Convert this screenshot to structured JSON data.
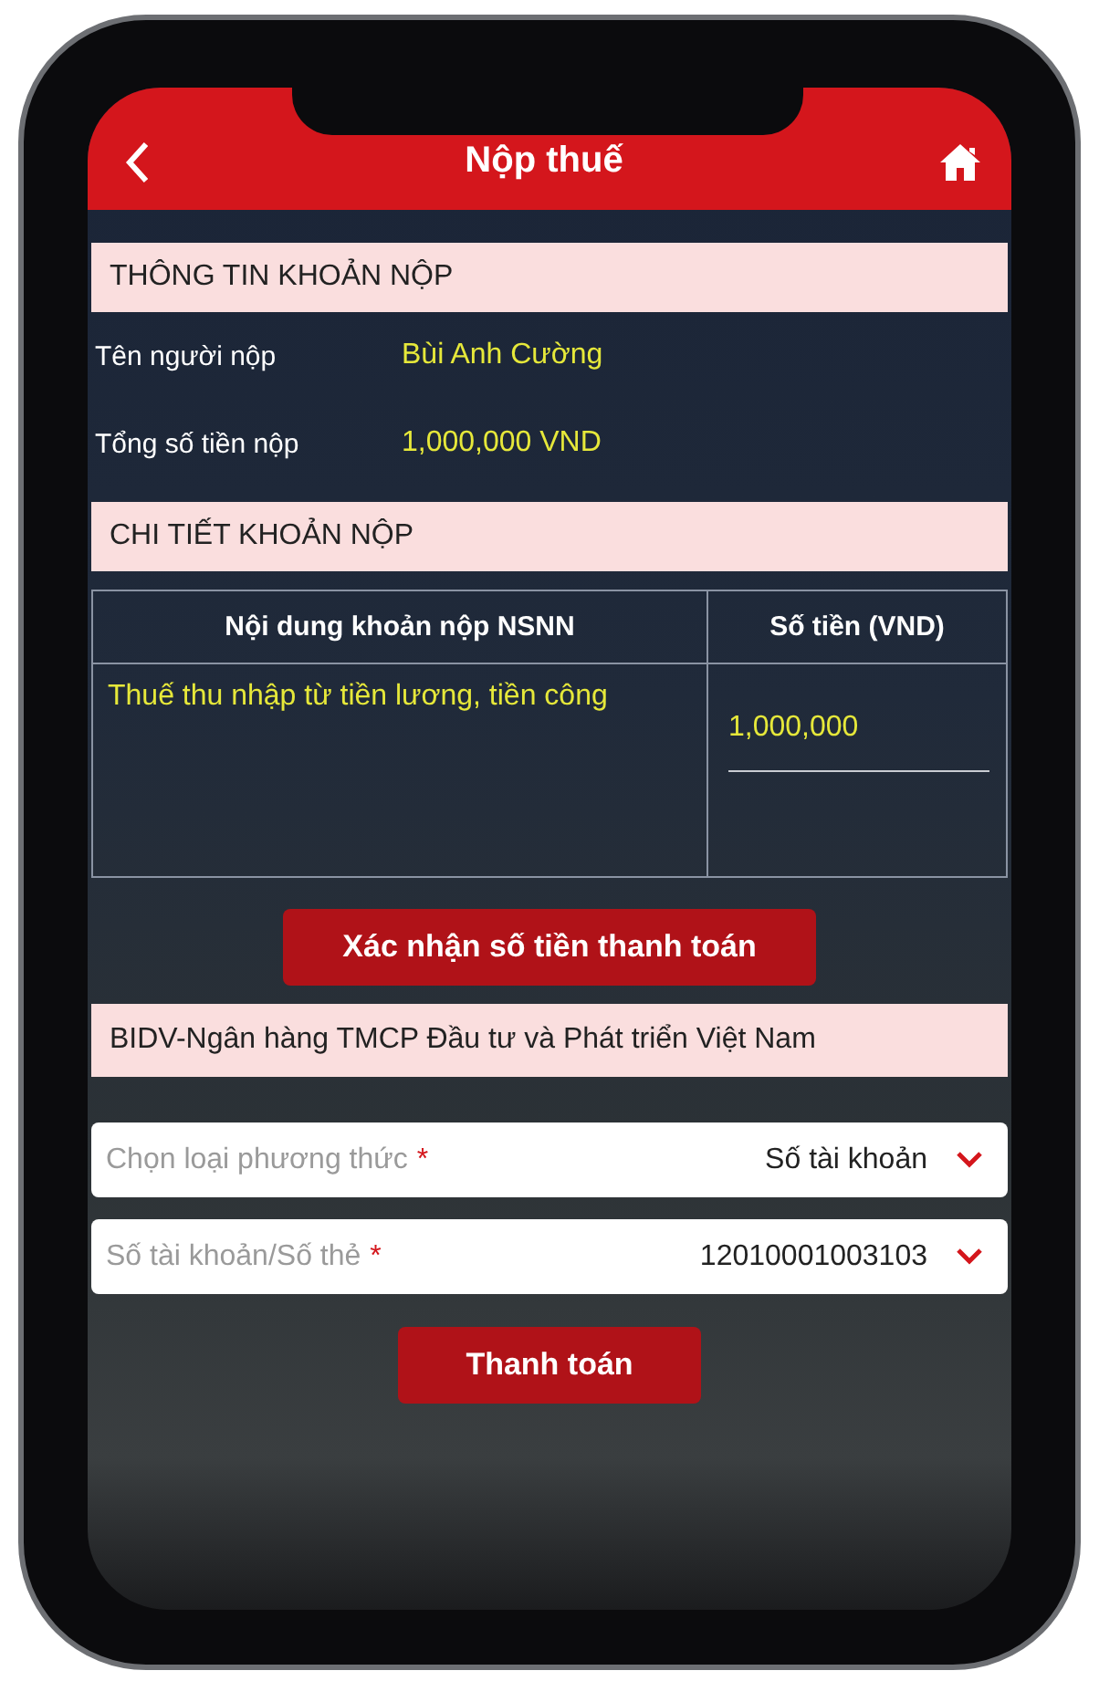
{
  "header": {
    "title": "Nộp thuế"
  },
  "payment_info": {
    "title": "THÔNG TIN KHOẢN NỘP",
    "rows": [
      {
        "label": "Tên người nộp",
        "value": "Bùi Anh Cường"
      },
      {
        "label": "Tổng số tiền nộp",
        "value": "1,000,000 VND"
      }
    ]
  },
  "payment_details": {
    "title": "CHI TIẾT KHOẢN NỘP",
    "table": {
      "columns": [
        "Nội dung khoản nộp NSNN",
        "Số tiền (VND)"
      ],
      "rows": [
        [
          "Thuế thu nhập từ tiền lương, tiền công",
          "1,000,000"
        ]
      ]
    }
  },
  "confirm_button": "Xác nhận số tiền thanh toán",
  "bank": {
    "title": "BIDV-Ngân hàng TMCP Đầu tư và Phát triển Việt Nam",
    "fields": [
      {
        "placeholder": "Chọn loại phương thức",
        "required_mark": "*",
        "value": "Số tài khoản"
      },
      {
        "placeholder": "Số tài khoản/Số thẻ",
        "required_mark": "*",
        "value": "12010001003103"
      }
    ]
  },
  "pay_button": "Thanh toán"
}
